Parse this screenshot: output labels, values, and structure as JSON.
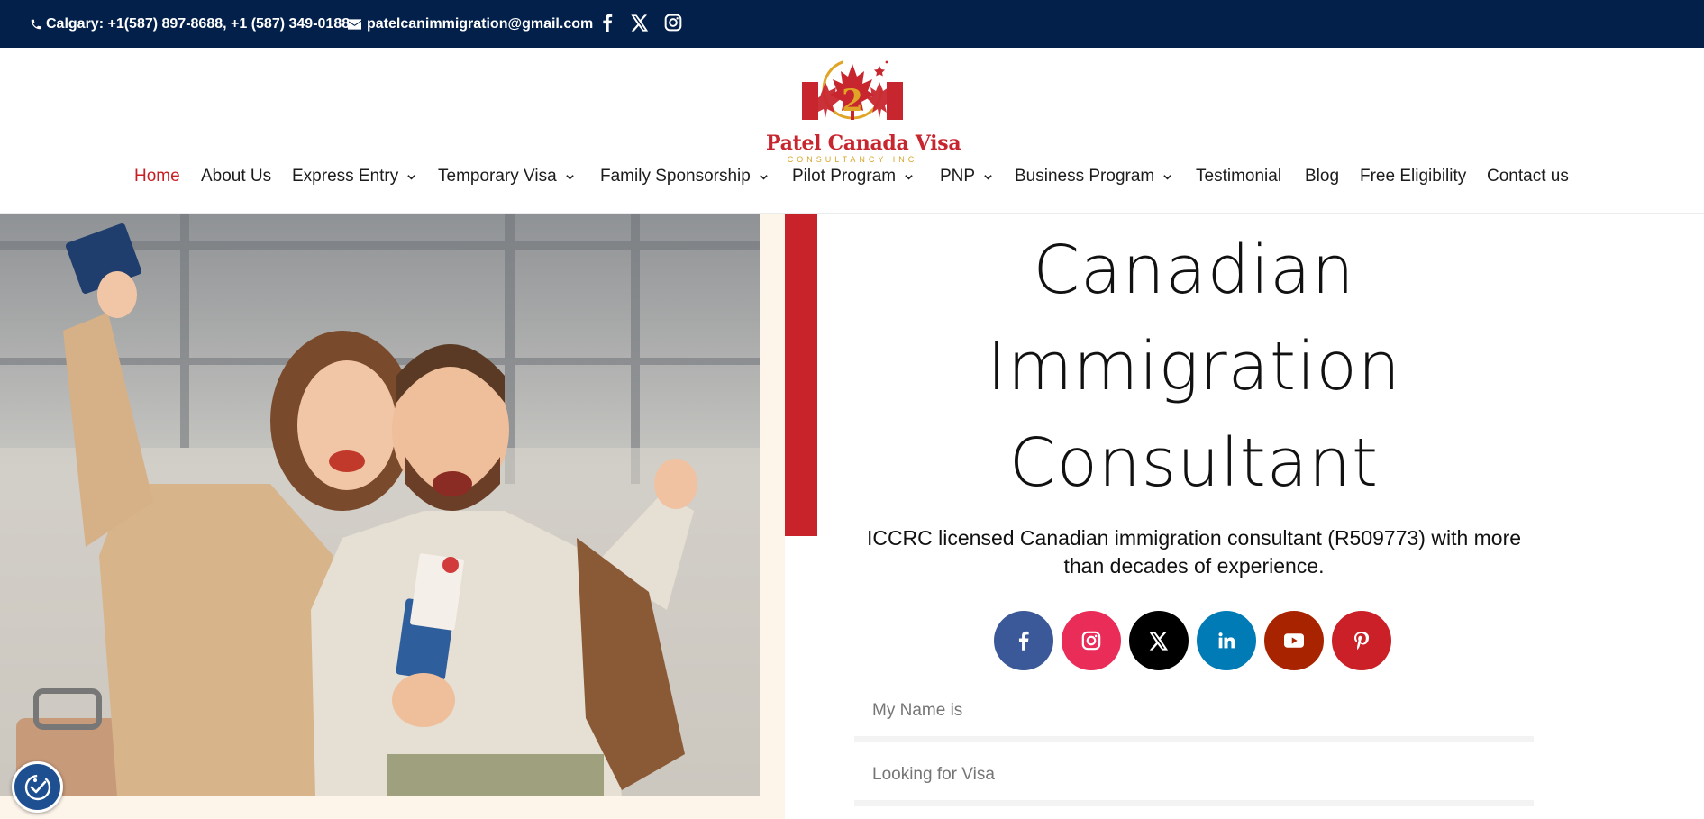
{
  "topbar": {
    "phone_text": "Calgary: +1(587) 897-8688, +1 (587) 349-0188",
    "email_text": "patelcanimmigration@gmail.com",
    "social_icons": [
      "facebook-icon",
      "x-icon",
      "instagram-icon"
    ]
  },
  "logo": {
    "name": "Patel Canada Visa",
    "subtitle": "CONSULTANCY INC"
  },
  "nav": {
    "items": [
      {
        "label": "Home",
        "active": true,
        "dropdown": false
      },
      {
        "label": "About Us",
        "dropdown": false
      },
      {
        "label": "Express Entry",
        "dropdown": true
      },
      {
        "label": "Temporary Visa",
        "dropdown": true
      },
      {
        "label": "Family Sponsorship",
        "dropdown": true
      },
      {
        "label": "Pilot Program",
        "dropdown": true
      },
      {
        "label": "PNP",
        "dropdown": true
      },
      {
        "label": "Business Program",
        "dropdown": true
      },
      {
        "label": "Testimonial",
        "dropdown": false
      },
      {
        "label": "Blog",
        "dropdown": false
      },
      {
        "label": "Free Eligibility",
        "dropdown": false
      },
      {
        "label": "Contact us",
        "dropdown": false
      }
    ]
  },
  "hero": {
    "headline_lines": [
      "Canadian",
      "Immigration",
      "Consultant"
    ],
    "subheadline": "ICCRC licensed Canadian immigration consultant (R509773) with more than decades of experience."
  },
  "social_buttons": [
    {
      "icon": "facebook-icon",
      "color": "#3b5998"
    },
    {
      "icon": "instagram-icon",
      "color": "#ea2c59"
    },
    {
      "icon": "x-icon",
      "color": "#000000"
    },
    {
      "icon": "linkedin-icon",
      "color": "#007bb6"
    },
    {
      "icon": "youtube-icon",
      "color": "#a82400"
    },
    {
      "icon": "pinterest-icon",
      "color": "#cb2027"
    }
  ],
  "form": {
    "name_placeholder": "My Name is",
    "visa_placeholder": "Looking for Visa"
  },
  "colors": {
    "topbar": "#02204a",
    "accent_red": "#c8222b",
    "cream": "#fdf5ea",
    "accessibility_button": "#1d4f91"
  }
}
